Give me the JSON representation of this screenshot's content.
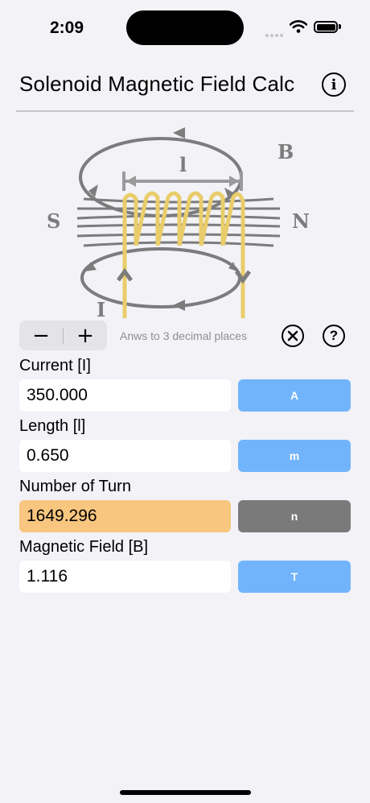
{
  "status": {
    "time": "2:09"
  },
  "header": {
    "title": "Solenoid Magnetic Field Calc"
  },
  "diagram": {
    "label_B": "B",
    "label_l": "l",
    "label_S": "S",
    "label_N": "N",
    "label_I": "I"
  },
  "controls": {
    "minus": "−",
    "plus": "+",
    "decimals_note": "Anws to 3 decimal places",
    "clear_icon": "⊗",
    "help_icon": "?"
  },
  "fields": [
    {
      "label": "Current [I]",
      "value": "350.000",
      "unit": "A"
    },
    {
      "label": "Length [l]",
      "value": "0.650",
      "unit": "m"
    },
    {
      "label": "Number of Turn",
      "value": "1649.296",
      "unit": "n"
    },
    {
      "label": "Magnetic Field [B]",
      "value": "1.116",
      "unit": "T"
    }
  ],
  "colors": {
    "accent_button": "#72b4fb",
    "solved_button": "#7a7a7a",
    "solved_field": "#f8c67e",
    "coil": "#e9cd6b"
  }
}
